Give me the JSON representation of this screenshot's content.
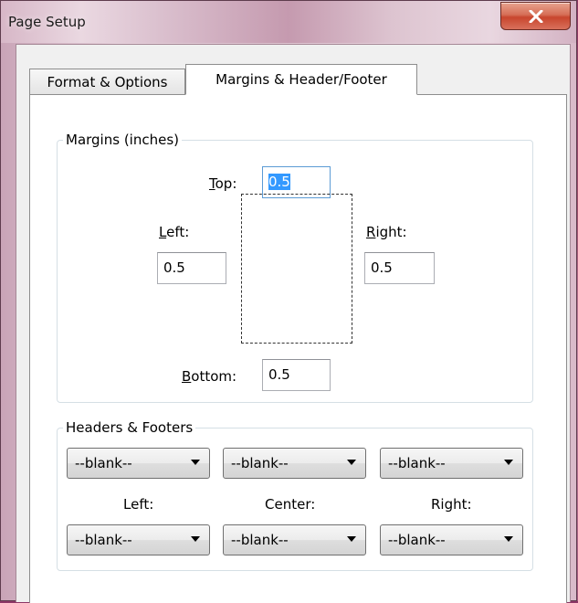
{
  "window": {
    "title": "Page Setup",
    "close_icon": "close-x-icon"
  },
  "tabs": [
    {
      "label": "Format & Options",
      "active": false
    },
    {
      "label": "Margins & Header/Footer",
      "active": true
    }
  ],
  "margins": {
    "legend": "Margins (inches)",
    "top": {
      "label_hotkey": "T",
      "label_rest": "op:",
      "value": "0.5"
    },
    "left": {
      "label_hotkey": "L",
      "label_rest": "eft:",
      "value": "0.5"
    },
    "right": {
      "label_hotkey": "R",
      "label_rest": "ight:",
      "value": "0.5"
    },
    "bottom": {
      "label_hotkey": "B",
      "label_rest": "ottom:",
      "value": "0.5"
    }
  },
  "headers_footers": {
    "legend": "Headers & Footers",
    "header_values": [
      "--blank--",
      "--blank--",
      "--blank--"
    ],
    "column_labels": [
      "Left:",
      "Center:",
      "Right:"
    ],
    "footer_values": [
      "--blank--",
      "--blank--",
      "--blank--"
    ]
  },
  "colors": {
    "selection": "#3399ff",
    "close_button": "#c8452d"
  }
}
